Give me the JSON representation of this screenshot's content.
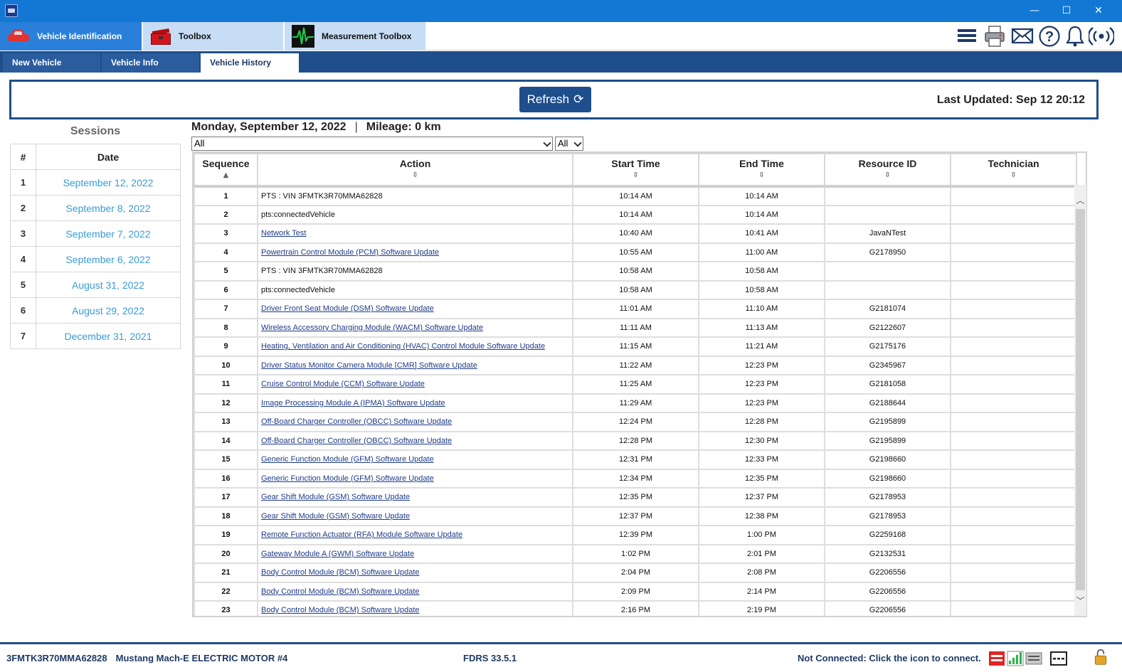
{
  "window": {
    "minimize": "—",
    "maximize": "☐",
    "close": "✕"
  },
  "main_tabs": [
    {
      "label": "Vehicle Identification",
      "icon": "car-icon",
      "active": true
    },
    {
      "label": "Toolbox",
      "icon": "toolbox-icon"
    },
    {
      "label": "Measurement Toolbox",
      "icon": "oscilloscope-icon"
    }
  ],
  "toolbar_icons": [
    "menu-icon",
    "printer-icon",
    "mail-icon",
    "help-icon",
    "bell-icon",
    "broadcast-icon"
  ],
  "sub_tabs": [
    {
      "label": "New Vehicle"
    },
    {
      "label": "Vehicle Info"
    },
    {
      "label": "Vehicle History",
      "active": true
    }
  ],
  "refresh": {
    "label": "Refresh",
    "icon": "refresh-icon"
  },
  "last_updated": "Last Updated: Sep 12 20:12",
  "sessions": {
    "title": "Sessions",
    "col_num": "#",
    "col_date": "Date",
    "rows": [
      {
        "num": "1",
        "date": "September 12, 2022"
      },
      {
        "num": "2",
        "date": "September 8, 2022"
      },
      {
        "num": "3",
        "date": "September 7, 2022"
      },
      {
        "num": "4",
        "date": "September 6, 2022"
      },
      {
        "num": "5",
        "date": "August 31, 2022"
      },
      {
        "num": "6",
        "date": "August 29, 2022"
      },
      {
        "num": "7",
        "date": "December 31, 2021"
      }
    ]
  },
  "history": {
    "date": "Monday, September 12, 2022",
    "separator": "|",
    "mileage": "Mileage: 0 km",
    "filter_action": "All",
    "filter_type": "All",
    "columns": [
      "Sequence",
      "Action",
      "Start Time",
      "End Time",
      "Resource ID",
      "Technician"
    ],
    "rows": [
      {
        "seq": "1",
        "action": "PTS : VIN 3FMTK3R70MMA62828",
        "link": false,
        "start": "10:14 AM",
        "end": "10:14 AM",
        "resource": "",
        "tech": ""
      },
      {
        "seq": "2",
        "action": "pts:connectedVehicle",
        "link": false,
        "start": "10:14 AM",
        "end": "10:14 AM",
        "resource": "",
        "tech": ""
      },
      {
        "seq": "3",
        "action": "Network Test",
        "link": true,
        "start": "10:40 AM",
        "end": "10:41 AM",
        "resource": "JavaNTest",
        "tech": ""
      },
      {
        "seq": "4",
        "action": "Powertrain Control Module (PCM) Software Update",
        "link": true,
        "start": "10:55 AM",
        "end": "11:00 AM",
        "resource": "G2178950",
        "tech": ""
      },
      {
        "seq": "5",
        "action": "PTS : VIN 3FMTK3R70MMA62828",
        "link": false,
        "start": "10:58 AM",
        "end": "10:58 AM",
        "resource": "",
        "tech": ""
      },
      {
        "seq": "6",
        "action": "pts:connectedVehicle",
        "link": false,
        "start": "10:58 AM",
        "end": "10:58 AM",
        "resource": "",
        "tech": ""
      },
      {
        "seq": "7",
        "action": "Driver Front Seat Module (DSM) Software Update",
        "link": true,
        "start": "11:01 AM",
        "end": "11:10 AM",
        "resource": "G2181074",
        "tech": ""
      },
      {
        "seq": "8",
        "action": "Wireless Accessory Charging Module (WACM) Software Update",
        "link": true,
        "start": "11:11 AM",
        "end": "11:13 AM",
        "resource": "G2122607",
        "tech": ""
      },
      {
        "seq": "9",
        "action": "Heating, Ventilation and Air Conditioning (HVAC) Control Module Software Update",
        "link": true,
        "start": "11:15 AM",
        "end": "11:21 AM",
        "resource": "G2175176",
        "tech": ""
      },
      {
        "seq": "10",
        "action": "Driver Status Monitor Camera Module [CMR] Software Update",
        "link": true,
        "start": "11:22 AM",
        "end": "12:23 PM",
        "resource": "G2345967",
        "tech": ""
      },
      {
        "seq": "11",
        "action": "Cruise Control Module (CCM) Software Update",
        "link": true,
        "start": "11:25 AM",
        "end": "12:23 PM",
        "resource": "G2181058",
        "tech": ""
      },
      {
        "seq": "12",
        "action": "Image Processing Module A (IPMA) Software Update",
        "link": true,
        "start": "11:29 AM",
        "end": "12:23 PM",
        "resource": "G2188644",
        "tech": ""
      },
      {
        "seq": "13",
        "action": "Off-Board Charger Controller (OBCC) Software Update",
        "link": true,
        "start": "12:24 PM",
        "end": "12:28 PM",
        "resource": "G2195899",
        "tech": ""
      },
      {
        "seq": "14",
        "action": "Off-Board Charger Controller (OBCC) Software Update",
        "link": true,
        "start": "12:28 PM",
        "end": "12:30 PM",
        "resource": "G2195899",
        "tech": ""
      },
      {
        "seq": "15",
        "action": "Generic Function Module (GFM) Software Update",
        "link": true,
        "start": "12:31 PM",
        "end": "12:33 PM",
        "resource": "G2198660",
        "tech": ""
      },
      {
        "seq": "16",
        "action": "Generic Function Module (GFM) Software Update",
        "link": true,
        "start": "12:34 PM",
        "end": "12:35 PM",
        "resource": "G2198660",
        "tech": ""
      },
      {
        "seq": "17",
        "action": "Gear Shift Module (GSM) Software Update",
        "link": true,
        "start": "12:35 PM",
        "end": "12:37 PM",
        "resource": "G2178953",
        "tech": ""
      },
      {
        "seq": "18",
        "action": "Gear Shift Module (GSM) Software Update",
        "link": true,
        "start": "12:37 PM",
        "end": "12:38 PM",
        "resource": "G2178953",
        "tech": ""
      },
      {
        "seq": "19",
        "action": "Remote Function Actuator (RFA) Module Software Update",
        "link": true,
        "start": "12:39 PM",
        "end": "1:00 PM",
        "resource": "G2259168",
        "tech": ""
      },
      {
        "seq": "20",
        "action": "Gateway Module A (GWM) Software Update",
        "link": true,
        "start": "1:02 PM",
        "end": "2:01 PM",
        "resource": "G2132531",
        "tech": ""
      },
      {
        "seq": "21",
        "action": "Body Control Module (BCM) Software Update",
        "link": true,
        "start": "2:04 PM",
        "end": "2:08 PM",
        "resource": "G2206556",
        "tech": ""
      },
      {
        "seq": "22",
        "action": "Body Control Module (BCM) Software Update",
        "link": true,
        "start": "2:09 PM",
        "end": "2:14 PM",
        "resource": "G2206556",
        "tech": ""
      },
      {
        "seq": "23",
        "action": "Body Control Module (BCM) Software Update",
        "link": true,
        "start": "2:16 PM",
        "end": "2:19 PM",
        "resource": "G2206556",
        "tech": ""
      }
    ]
  },
  "status": {
    "vin": "3FMTK3R70MMA62828",
    "vehicle": "Mustang Mach-E ELECTRIC MOTOR #4",
    "version": "FDRS 33.5.1",
    "connection": "Not Connected: Click the icon to connect.",
    "icons": [
      "vci-icon",
      "signal-icon",
      "network-card-icon",
      "dashes-icon",
      "lock-icon"
    ]
  },
  "colors": {
    "titlebar": "#1378d4",
    "active_tab": "#2a7fda",
    "subtab_bar": "#1f4f8a",
    "refresh_button": "#1e4e8c",
    "session_date": "#3a9bd6",
    "link": "#1f3c88"
  }
}
